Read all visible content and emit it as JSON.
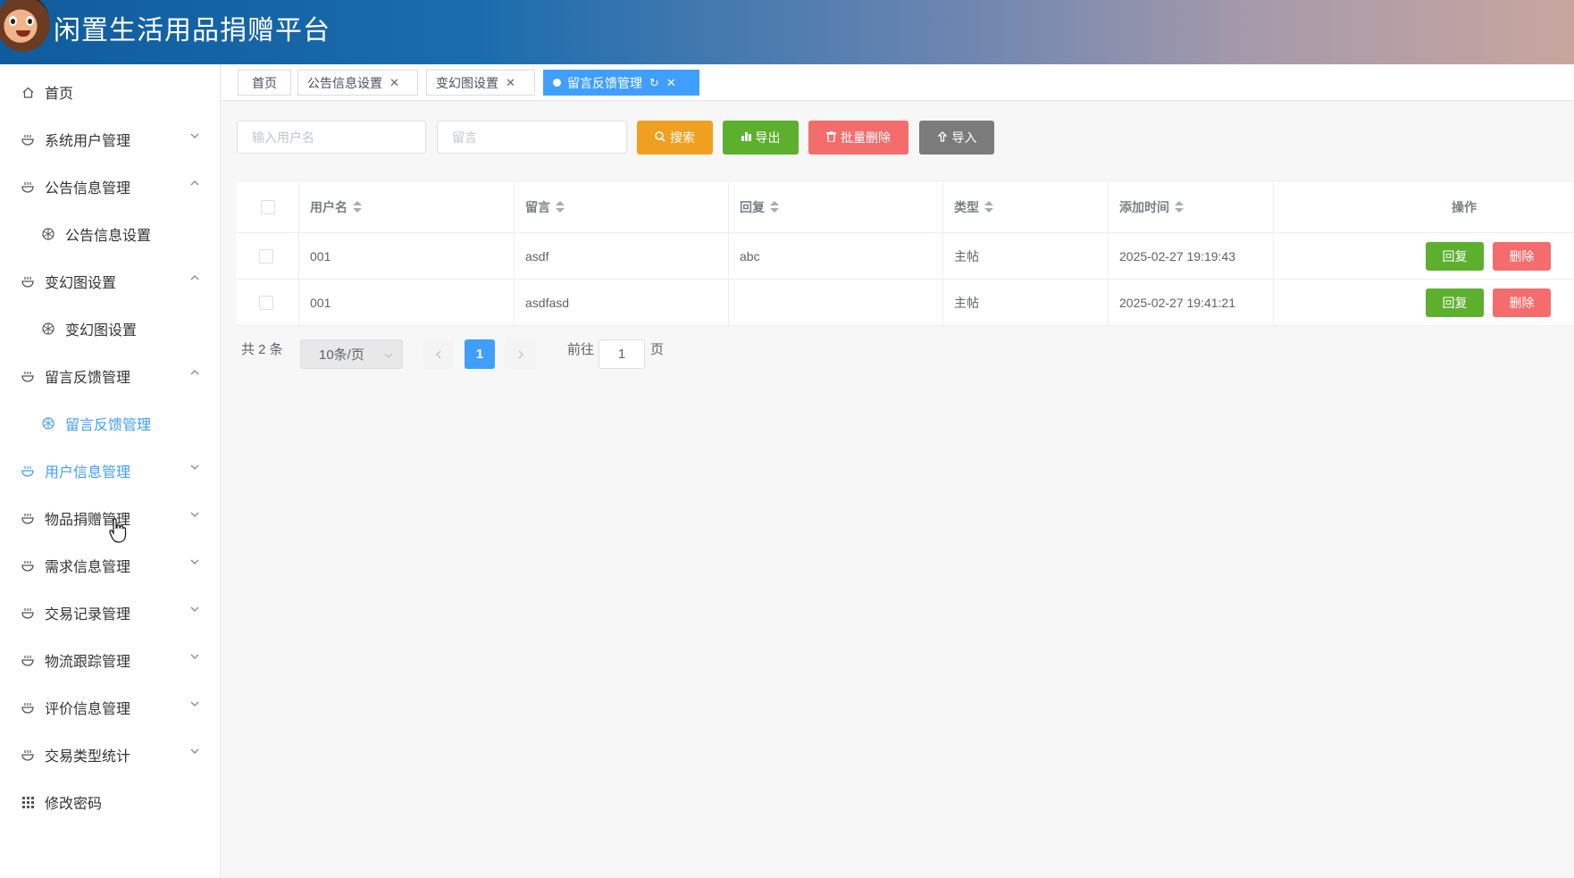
{
  "header": {
    "title": "闲置生活用品捐赠平台"
  },
  "sidebar": {
    "items": [
      {
        "label": "首页",
        "icon": "home-icon",
        "arrow": ""
      },
      {
        "label": "系统用户管理",
        "icon": "bowl-icon",
        "arrow": "down"
      },
      {
        "label": "公告信息管理",
        "icon": "bowl-icon",
        "arrow": "up"
      },
      {
        "label": "公告信息设置",
        "icon": "aperture-icon",
        "arrow": "",
        "sub": true
      },
      {
        "label": "变幻图设置",
        "icon": "bowl-icon",
        "arrow": "up"
      },
      {
        "label": "变幻图设置",
        "icon": "aperture-icon",
        "arrow": "",
        "sub": true
      },
      {
        "label": "留言反馈管理",
        "icon": "bowl-icon",
        "arrow": "up"
      },
      {
        "label": "留言反馈管理",
        "icon": "aperture-icon",
        "arrow": "",
        "sub": true,
        "active": true
      },
      {
        "label": "用户信息管理",
        "icon": "bowl-icon",
        "arrow": "down",
        "hover": true
      },
      {
        "label": "物品捐赠管理",
        "icon": "bowl-icon",
        "arrow": "down"
      },
      {
        "label": "需求信息管理",
        "icon": "bowl-icon",
        "arrow": "down"
      },
      {
        "label": "交易记录管理",
        "icon": "bowl-icon",
        "arrow": "down"
      },
      {
        "label": "物流跟踪管理",
        "icon": "bowl-icon",
        "arrow": "down"
      },
      {
        "label": "评价信息管理",
        "icon": "bowl-icon",
        "arrow": "down"
      },
      {
        "label": "交易类型统计",
        "icon": "bowl-icon",
        "arrow": "down"
      },
      {
        "label": "修改密码",
        "icon": "grid-icon",
        "arrow": ""
      }
    ]
  },
  "tabs": [
    {
      "label": "首页",
      "closable": false
    },
    {
      "label": "公告信息设置",
      "closable": true
    },
    {
      "label": "变幻图设置",
      "closable": true
    },
    {
      "label": "留言反馈管理",
      "closable": true,
      "active": true
    }
  ],
  "search": {
    "username_placeholder": "输入用户名",
    "message_placeholder": "留言",
    "search_label": "搜索",
    "export_label": "导出",
    "batch_delete_label": "批量删除",
    "import_label": "导入"
  },
  "table": {
    "columns": [
      "用户名",
      "留言",
      "回复",
      "类型",
      "添加时间",
      "操作"
    ],
    "rows": [
      {
        "username": "001",
        "message": "asdf",
        "reply": "abc",
        "type": "主帖",
        "time": "2025-02-27 19:19:43"
      },
      {
        "username": "001",
        "message": "asdfasd",
        "reply": "",
        "type": "主帖",
        "time": "2025-02-27 19:41:21"
      }
    ],
    "reply_label": "回复",
    "delete_label": "删除"
  },
  "pagination": {
    "total_text": "共 2 条",
    "page_size": "10条/页",
    "current_page": "1",
    "goto_label": "前往",
    "goto_value": "1",
    "page_suffix": "页"
  },
  "colors": {
    "primary": "#409eff",
    "search": "#f0a020",
    "export": "#5cb02e",
    "danger": "#f56c6c",
    "import": "#7b7b7b"
  }
}
